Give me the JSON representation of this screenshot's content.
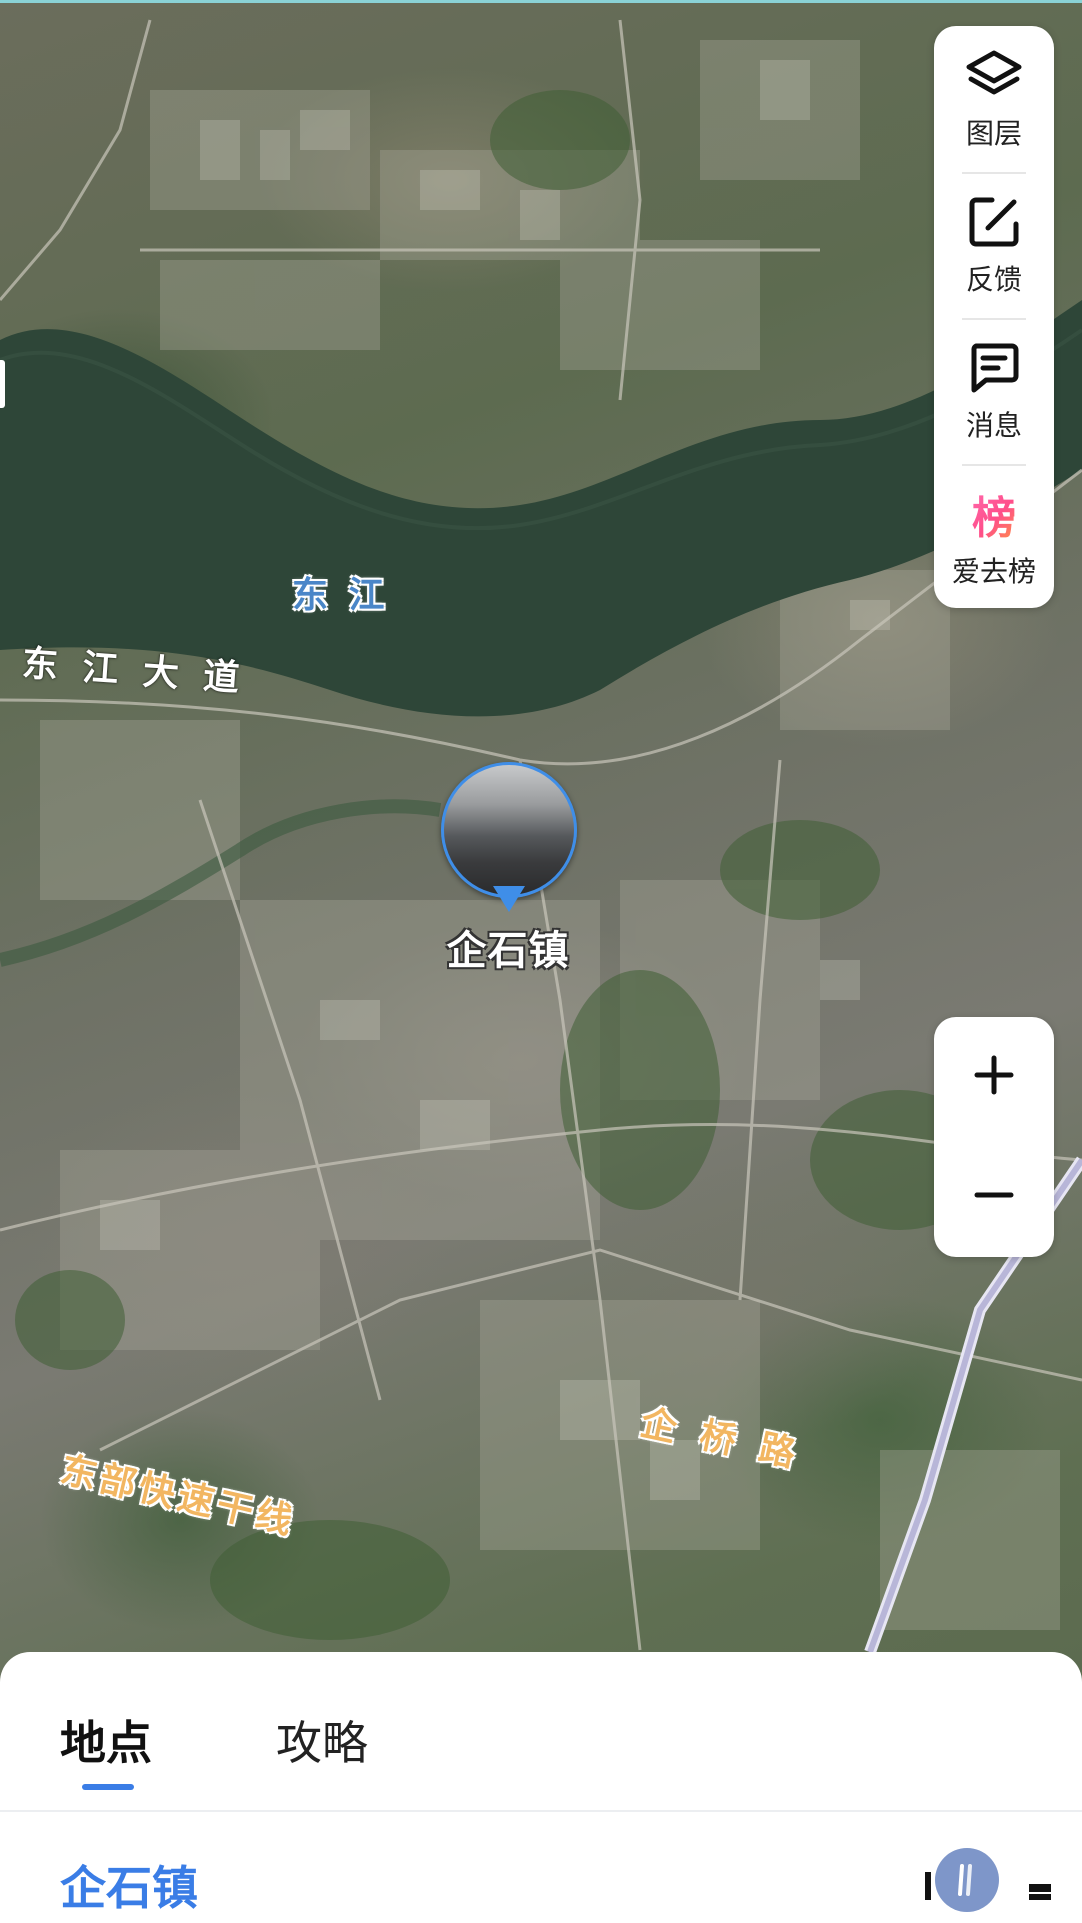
{
  "map": {
    "labels": {
      "river": "东 江",
      "road_dongjiang": "东 江 大 道",
      "road_east_express": "东部快速干线",
      "road_qiqiao": "企 桥 路"
    },
    "marker_name": "企石镇"
  },
  "toolbar": {
    "layers_label": "图层",
    "feedback_label": "反馈",
    "messages_label": "消息",
    "rank_glyph": "榜",
    "rank_label": "爱去榜"
  },
  "zoom": {
    "in_glyph": "+",
    "out_glyph": "−"
  },
  "sheet": {
    "tabs": [
      {
        "label": "地点",
        "active": true
      },
      {
        "label": "攻略",
        "active": false
      }
    ],
    "place_title": "企石镇"
  },
  "colors": {
    "accent": "#3a7de6",
    "marker": "#3f8ee8",
    "water_label": "#4a86c8",
    "road_label": "#f2b661"
  }
}
